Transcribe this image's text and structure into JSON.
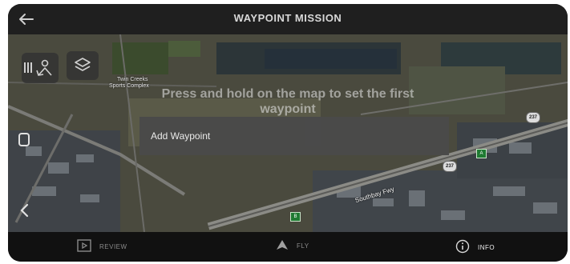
{
  "header": {
    "title": "WAYPOINT MISSION",
    "back_icon": "back-arrow-icon"
  },
  "map": {
    "hint_text_line1": "Press and hold on the map to set the first",
    "hint_text_line2": "waypoint",
    "popup_button_label": "Add Waypoint",
    "place_labels": {
      "twin_creeks_line1": "Twin Creeks",
      "twin_creeks_line2": "Sports Complex"
    },
    "road_labels": {
      "southbay": "Southbay Fwy"
    },
    "highway_shields": [
      "237",
      "237"
    ],
    "green_signs": [
      "A",
      "B"
    ],
    "left_controls": {
      "menu_icon": "menu-lines-icon",
      "person_icon": "user-location-icon",
      "layers_icon": "layers-icon",
      "rect_icon": "square-icon",
      "chevron_icon": "chevron-left-icon"
    }
  },
  "bottom_nav": {
    "items": [
      {
        "label": "REVIEW",
        "icon": "play-box-icon"
      },
      {
        "label": "FLY",
        "icon": "plane-arrow-icon"
      },
      {
        "label": "INFO",
        "icon": "info-circle-icon"
      }
    ]
  },
  "colors": {
    "topbar_bg": "#1f1f1f",
    "bottombar_bg": "#111111",
    "popup_bg": "#4a4a4a",
    "text_light": "#f0f0f0"
  }
}
